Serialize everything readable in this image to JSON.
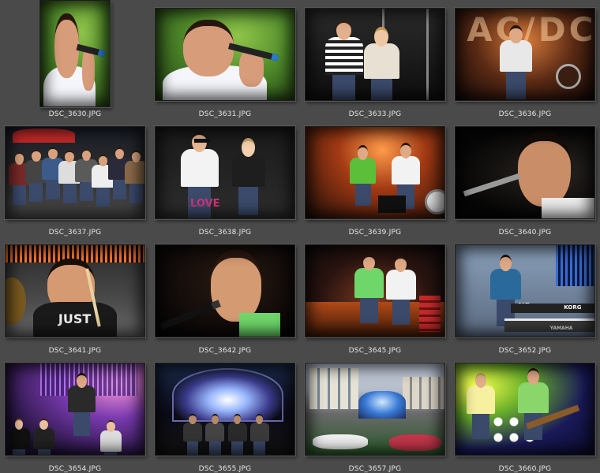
{
  "photos": [
    {
      "file": "DSC_3630.JPG",
      "scene": "singer-green",
      "orientation": "portrait"
    },
    {
      "file": "DSC_3631.JPG",
      "scene": "singer-green",
      "orientation": "landscape"
    },
    {
      "file": "DSC_3633.JPG",
      "scene": "crowd-women",
      "orientation": "landscape"
    },
    {
      "file": "DSC_3636.JPG",
      "scene": "stage-guitar",
      "orientation": "landscape"
    },
    {
      "file": "DSC_3637.JPG",
      "scene": "crowd-street",
      "orientation": "landscape"
    },
    {
      "file": "DSC_3638.JPG",
      "scene": "crowd-women-night",
      "orientation": "landscape"
    },
    {
      "file": "DSC_3639.JPG",
      "scene": "stage-band",
      "orientation": "landscape"
    },
    {
      "file": "DSC_3640.JPG",
      "scene": "singer-dark",
      "orientation": "landscape"
    },
    {
      "file": "DSC_3641.JPG",
      "scene": "drummer",
      "orientation": "landscape"
    },
    {
      "file": "DSC_3642.JPG",
      "scene": "singer-mic",
      "orientation": "landscape"
    },
    {
      "file": "DSC_3645.JPG",
      "scene": "stage-guitarists",
      "orientation": "landscape"
    },
    {
      "file": "DSC_3652.JPG",
      "scene": "keyboardist",
      "orientation": "landscape"
    },
    {
      "file": "DSC_3654.JPG",
      "scene": "stage-purple",
      "orientation": "landscape"
    },
    {
      "file": "DSC_3655.JPG",
      "scene": "stage-wide-night",
      "orientation": "landscape"
    },
    {
      "file": "DSC_3657.JPG",
      "scene": "square-day",
      "orientation": "landscape"
    },
    {
      "file": "DSC_3660.JPG",
      "scene": "stage-yellow",
      "orientation": "landscape"
    }
  ],
  "thumb_texts": {
    "shirt_just": "JUST",
    "shirt_n5": "N5",
    "shirt_love": "LOVE",
    "brand_korg": "KORG",
    "brand_yamaha": "YAMAHA",
    "sign_acdc": "AC/DC"
  },
  "colors": {
    "background": "#4a4a4a",
    "label": "#e6e6e6",
    "thumb_border": "#1c1c1c"
  }
}
